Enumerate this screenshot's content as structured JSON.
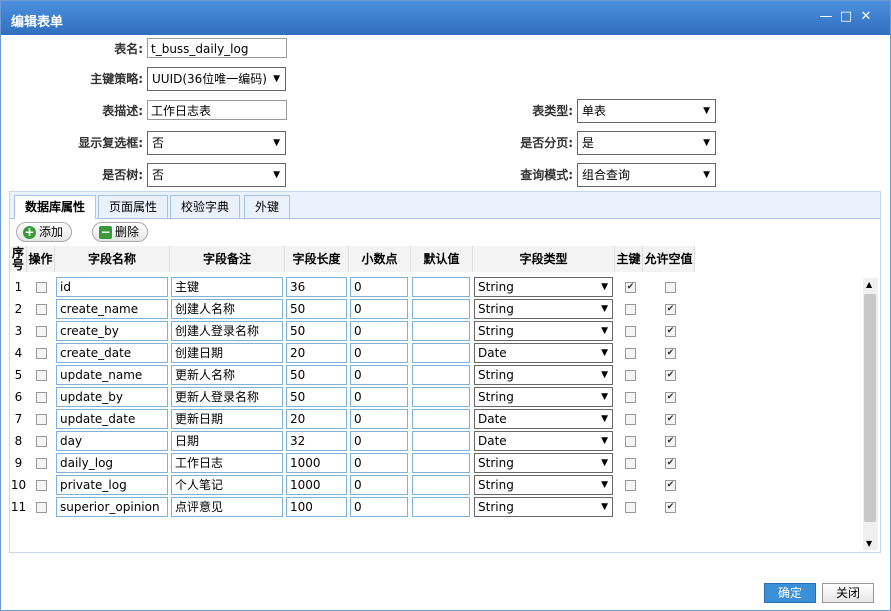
{
  "window": {
    "title": "编辑表单"
  },
  "form": {
    "table_name": {
      "label": "表名:",
      "value": "t_buss_daily_log"
    },
    "pk_strategy": {
      "label": "主键策略:",
      "value": "UUID(36位唯一编码)"
    },
    "table_desc": {
      "label": "表描述:",
      "value": "工作日志表"
    },
    "table_type": {
      "label": "表类型:",
      "value": "单表"
    },
    "show_checkbox": {
      "label": "显示复选框:",
      "value": "否"
    },
    "paging": {
      "label": "是否分页:",
      "value": "是"
    },
    "is_tree": {
      "label": "是否树:",
      "value": "否"
    },
    "query_mode": {
      "label": "查询模式:",
      "value": "组合查询"
    }
  },
  "tabs": [
    {
      "label": "数据库属性",
      "active": true
    },
    {
      "label": "页面属性",
      "active": false
    },
    {
      "label": "校验字典",
      "active": false
    },
    {
      "label": "外键",
      "active": false
    }
  ],
  "toolbar": {
    "add_label": "添加",
    "delete_label": "删除"
  },
  "columns": [
    "序号",
    "操作",
    "字段名称",
    "字段备注",
    "字段长度",
    "小数点",
    "默认值",
    "字段类型",
    "主键",
    "允许空值"
  ],
  "rows": [
    {
      "num": "1",
      "name": "id",
      "comment": "主键",
      "length": "36",
      "decimal": "0",
      "default": "",
      "type": "String",
      "pk": true,
      "nullable": false
    },
    {
      "num": "2",
      "name": "create_name",
      "comment": "创建人名称",
      "length": "50",
      "decimal": "0",
      "default": "",
      "type": "String",
      "pk": false,
      "nullable": true
    },
    {
      "num": "3",
      "name": "create_by",
      "comment": "创建人登录名称",
      "length": "50",
      "decimal": "0",
      "default": "",
      "type": "String",
      "pk": false,
      "nullable": true
    },
    {
      "num": "4",
      "name": "create_date",
      "comment": "创建日期",
      "length": "20",
      "decimal": "0",
      "default": "",
      "type": "Date",
      "pk": false,
      "nullable": true
    },
    {
      "num": "5",
      "name": "update_name",
      "comment": "更新人名称",
      "length": "50",
      "decimal": "0",
      "default": "",
      "type": "String",
      "pk": false,
      "nullable": true
    },
    {
      "num": "6",
      "name": "update_by",
      "comment": "更新人登录名称",
      "length": "50",
      "decimal": "0",
      "default": "",
      "type": "String",
      "pk": false,
      "nullable": true
    },
    {
      "num": "7",
      "name": "update_date",
      "comment": "更新日期",
      "length": "20",
      "decimal": "0",
      "default": "",
      "type": "Date",
      "pk": false,
      "nullable": true
    },
    {
      "num": "8",
      "name": "day",
      "comment": "日期",
      "length": "32",
      "decimal": "0",
      "default": "",
      "type": "Date",
      "pk": false,
      "nullable": true
    },
    {
      "num": "9",
      "name": "daily_log",
      "comment": "工作日志",
      "length": "1000",
      "decimal": "0",
      "default": "",
      "type": "String",
      "pk": false,
      "nullable": true
    },
    {
      "num": "10",
      "name": "private_log",
      "comment": "个人笔记",
      "length": "1000",
      "decimal": "0",
      "default": "",
      "type": "String",
      "pk": false,
      "nullable": true
    },
    {
      "num": "11",
      "name": "superior_opinion",
      "comment": "点评意见",
      "length": "100",
      "decimal": "0",
      "default": "",
      "type": "String",
      "pk": false,
      "nullable": true
    }
  ],
  "footer": {
    "confirm_label": "确定",
    "close_label": "关闭"
  },
  "colors": {
    "title_bar": "#3a7fcf",
    "confirm_button": "#3b8fd6",
    "input_border": "#7fb2d8"
  }
}
